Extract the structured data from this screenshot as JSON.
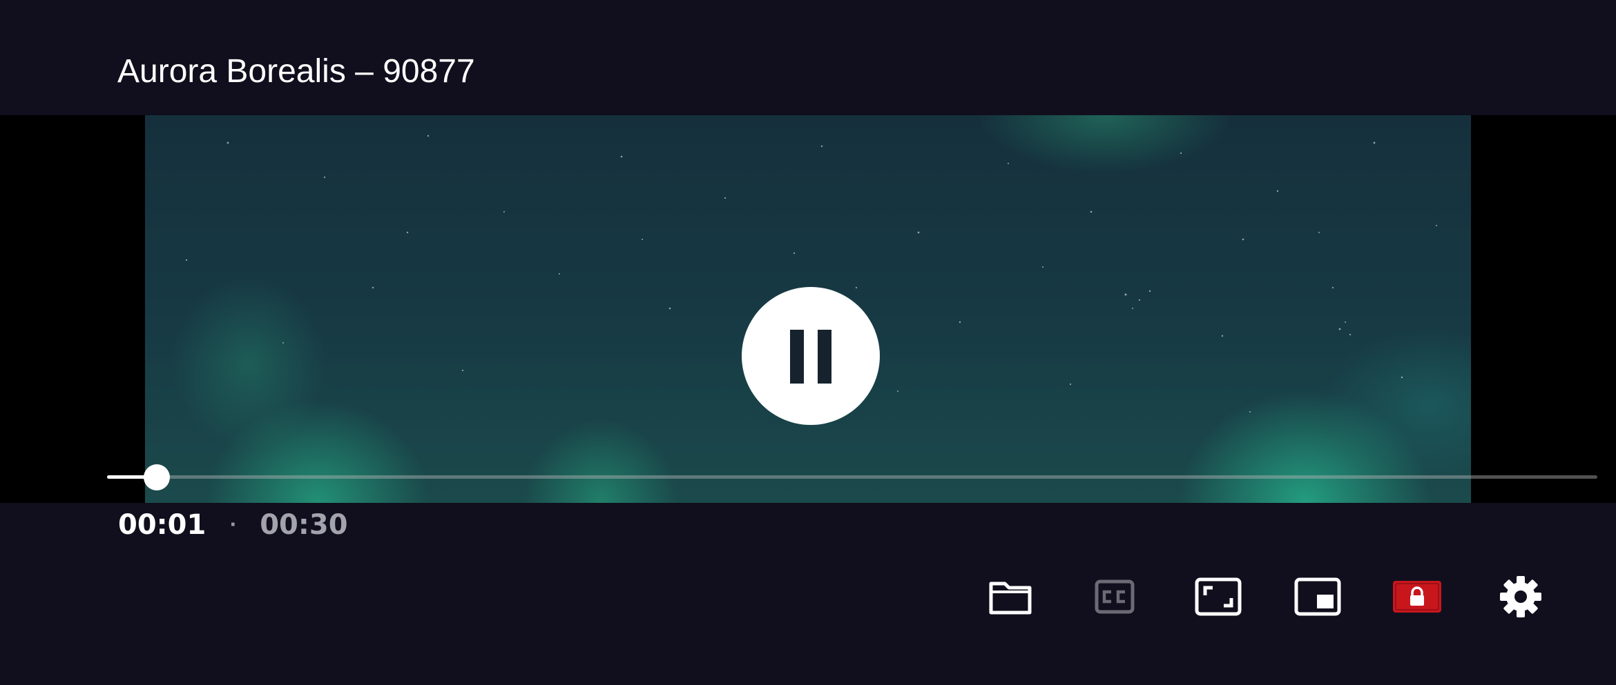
{
  "header": {
    "title": "Aurora Borealis – 90877"
  },
  "player": {
    "state": "playing",
    "current_time": "00:01",
    "separator": "·",
    "total_time": "00:30",
    "progress_fraction": 0.0333
  },
  "toolbar": {
    "buttons": [
      {
        "name": "open-folder",
        "icon": "folder-icon",
        "color": "#ffffff"
      },
      {
        "name": "subtitles",
        "icon": "closed-captions-icon",
        "color": "#6b6b75"
      },
      {
        "name": "fullscreen",
        "icon": "aspect-ratio-icon",
        "color": "#ffffff"
      },
      {
        "name": "picture-in-picture",
        "icon": "pip-icon",
        "color": "#ffffff"
      },
      {
        "name": "lock-screen",
        "icon": "lock-icon",
        "color": "#c8161d"
      },
      {
        "name": "settings",
        "icon": "gear-icon",
        "color": "#ffffff"
      }
    ]
  },
  "colors": {
    "background": "#110f1d",
    "accent_lock": "#c8161d",
    "text_primary": "#ffffff",
    "text_secondary": "#a3a3ad"
  }
}
